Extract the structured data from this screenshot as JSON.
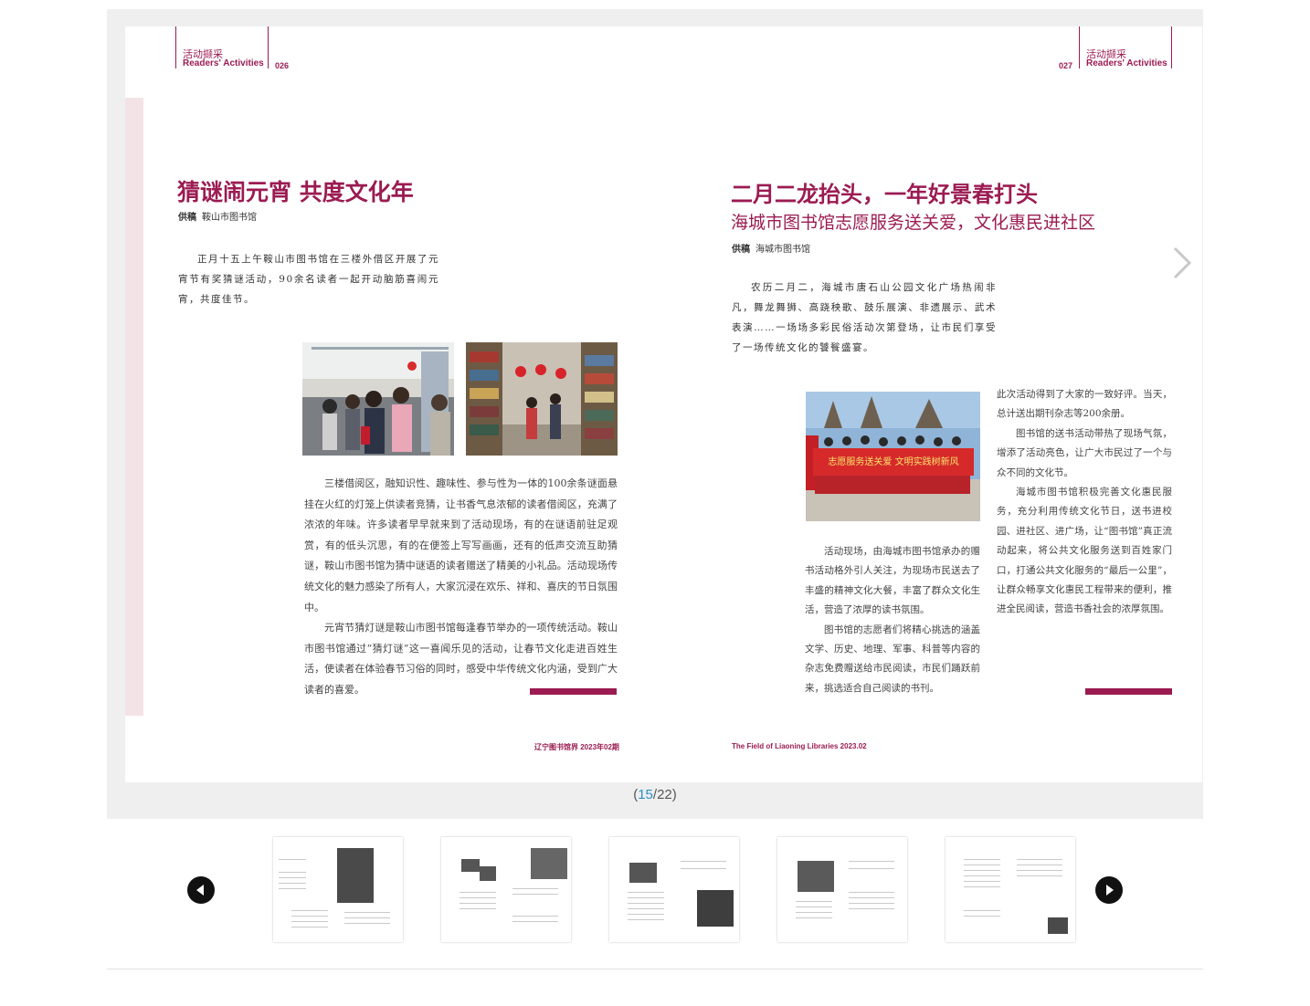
{
  "left_page": {
    "header_cn": "活动撷采",
    "header_en": "Readers' Activities",
    "page_number": "026",
    "title": "猜谜闹元宵  共度文化年",
    "byline_label": "供稿",
    "byline_source": "鞍山市图书馆",
    "lead": "正月十五上午鞍山市图书馆在三楼外借区开展了元宵节有奖猜谜活动，90余名读者一起开动脑筋喜闹元宵，共度佳节。",
    "body": [
      "三楼借阅区，融知识性、趣味性、参与性为一体的100余条谜面悬挂在火红的灯笼上供读者竞猜，让书香气息浓郁的读者借阅区，充满了浓浓的年味。许多读者早早就来到了活动现场，有的在谜语前驻足观赏，有的低头沉思，有的在便签上写写画画，还有的低声交流互助猜谜，鞍山市图书馆为猜中谜语的读者赠送了精美的小礼品。活动现场传统文化的魅力感染了所有人，大家沉浸在欢乐、祥和、喜庆的节日氛围中。",
      "元宵节猜灯谜是鞍山市图书馆每逢春节举办的一项传统活动。鞍山市图书馆通过“猜灯谜”这一喜闻乐见的活动，让春节文化走进百姓生活，使读者在体验春节习俗的同时，感受中华传统文化内涵，受到广大读者的喜爱。"
    ],
    "footer": "辽宁图书馆界  2023年02期"
  },
  "right_page": {
    "header_cn": "活动撷采",
    "header_en": "Readers' Activities",
    "page_number": "027",
    "title": "二月二龙抬头，一年好景春打头",
    "subtitle": "海城市图书馆志愿服务送关爱，文化惠民进社区",
    "byline_label": "供稿",
    "byline_source": "海城市图书馆",
    "lead": "农历二月二，海城市唐石山公园文化广场热闹非凡，舞龙舞狮、高跷秧歌、鼓乐展演、非遗展示、武术表演……一场场多彩民俗活动次第登场，让市民们享受了一场传统文化的饕餮盛宴。",
    "body_left": [
      "活动现场，由海城市图书馆承办的赠书活动格外引人关注，为现场市民送去了丰盛的精神文化大餐，丰富了群众文化生活，营造了浓厚的读书氛围。",
      "图书馆的志愿者们将精心挑选的涵盖文学、历史、地理、军事、科普等内容的杂志免费赠送给市民阅读，市民们踊跃前来，挑选适合自己阅读的书刊。"
    ],
    "body_right_cont": "此次活动得到了大家的一致好评。当天，总计送出期刊杂志等200余册。",
    "body_right": [
      "图书馆的送书活动带热了现场气氛，增添了活动亮色，让广大市民过了一个与众不同的文化节。",
      "海城市图书馆积极完善文化惠民服务，充分利用传统文化节日，送书进校园、进社区、进广场，让“图书馆”真正流动起来，将公共文化服务送到百姓家门口，打通公共文化服务的“最后一公里”，让群众畅享文化惠民工程带来的便利，推进全民阅读，营造书香社会的浓厚氛围。"
    ],
    "banner_text": "志愿服务送关爱  文明实践树新风",
    "footer": "The Field of Liaoning Libraries 2023.02"
  },
  "pager": {
    "open": "(",
    "current": "15",
    "sep": "/",
    "total": "22",
    "close": ")"
  },
  "icons": {
    "next_page": "chevron-right-icon",
    "thumb_prev": "triangle-left-icon",
    "thumb_next": "triangle-right-icon"
  },
  "colors": {
    "accent": "#9b1b52",
    "page_counter": "#2a8fc7",
    "viewer_bg": "#efefef"
  }
}
